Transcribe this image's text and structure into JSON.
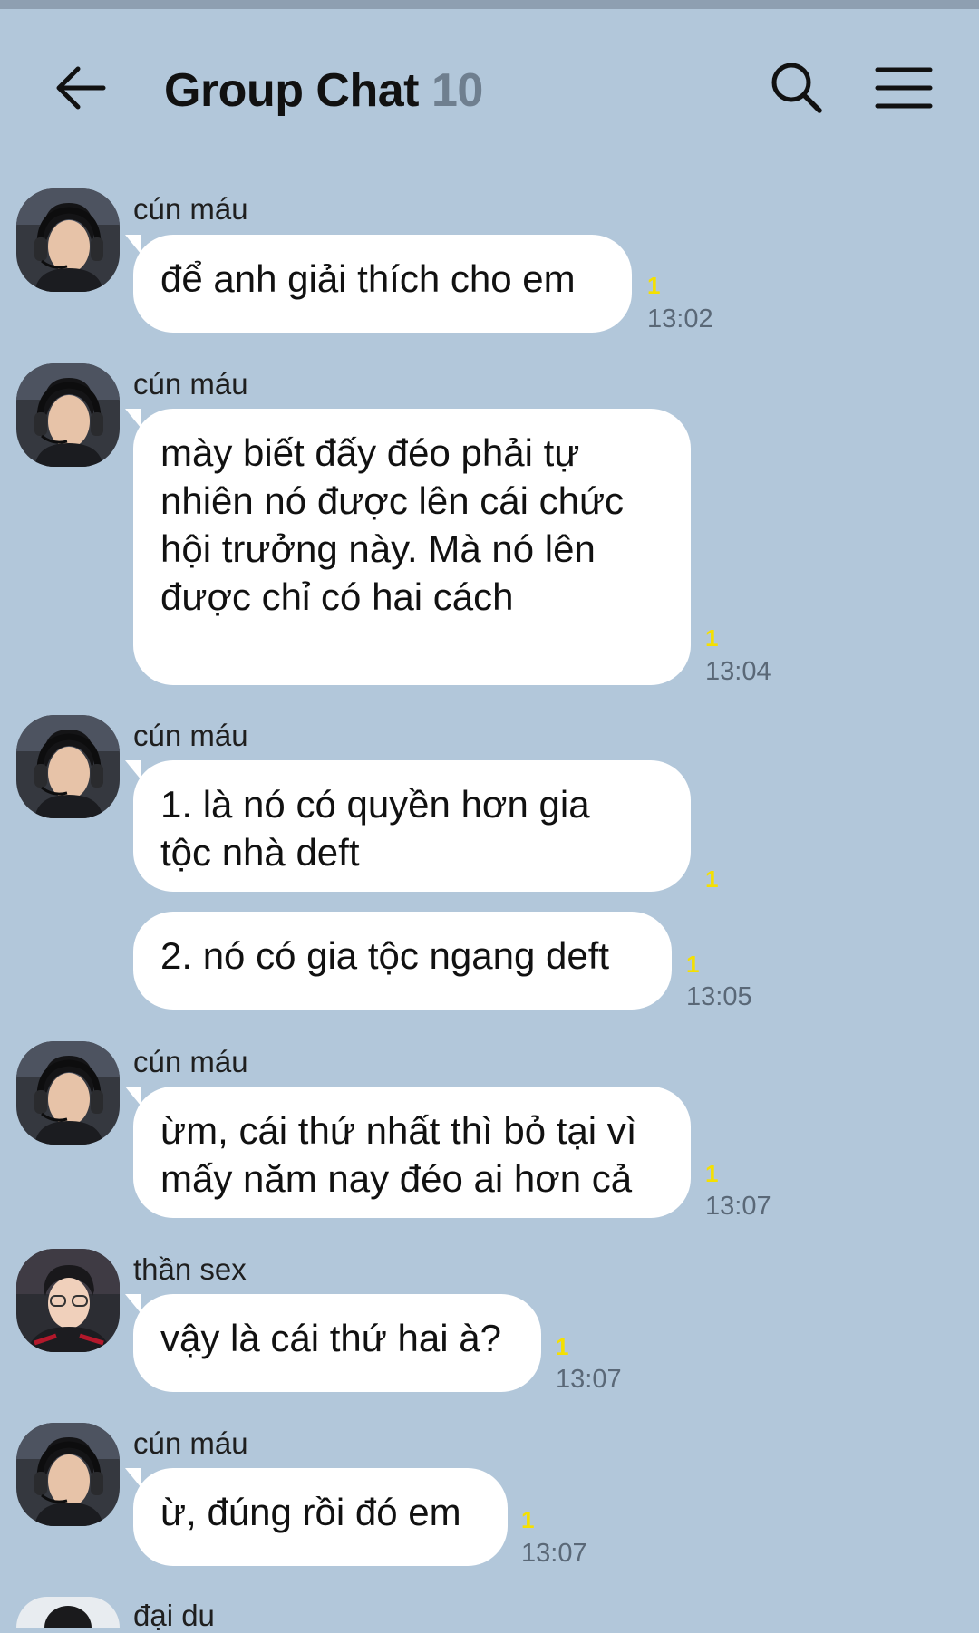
{
  "header": {
    "title": "Group Chat",
    "member_count": "10",
    "back_icon": "arrow-left-icon",
    "search_icon": "search-icon",
    "menu_icon": "hamburger-menu-icon"
  },
  "colors": {
    "background": "#b2c7da",
    "bubble": "#ffffff",
    "unread": "#f5e000",
    "count": "#6f7f8f"
  },
  "messages": [
    {
      "sender": "cún máu",
      "text": "để anh giải thích cho em",
      "unread": "1",
      "time": "13:02"
    },
    {
      "sender": "cún máu",
      "lines": [
        "mày biết đấy đéo phải tự",
        "nhiên nó được lên cái chức",
        "hội trưởng này. Mà nó lên",
        "được chỉ có hai cách"
      ],
      "unread": "1",
      "time": "13:04"
    },
    {
      "sender": "cún máu",
      "lines": [
        "1. là nó có quyền hơn gia",
        "tộc nhà deft"
      ],
      "unread": "1",
      "time": ""
    },
    {
      "sender": "",
      "text": "2. nó có gia tộc ngang deft",
      "unread": "1",
      "time": "13:05"
    },
    {
      "sender": "cún máu",
      "lines": [
        "ừm, cái thứ nhất thì bỏ tại vì",
        "mấy năm nay đéo ai hơn cả"
      ],
      "unread": "1",
      "time": "13:07"
    },
    {
      "sender": "thần sex",
      "text": "vậy là cái thứ hai à?",
      "unread": "1",
      "time": "13:07"
    },
    {
      "sender": "cún máu",
      "text": "ừ, đúng rồi đó em",
      "unread": "1",
      "time": "13:07"
    },
    {
      "sender": "đại du",
      "text": "",
      "unread": "",
      "time": ""
    }
  ]
}
